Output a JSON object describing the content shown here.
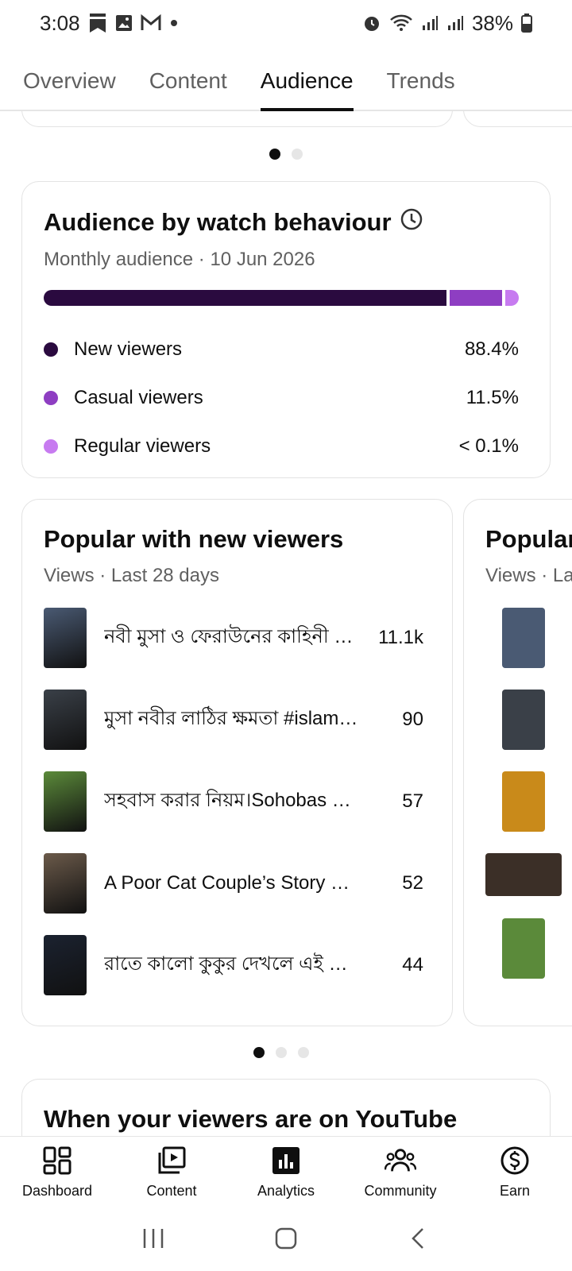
{
  "status_bar": {
    "time": "3:08",
    "battery": "38%",
    "icons": [
      "bookmark-icon",
      "image-icon",
      "gmail-icon",
      "dot-icon",
      "alarm-icon",
      "wifi-icon",
      "signal-icon",
      "signal-icon",
      "battery-icon"
    ]
  },
  "tabs": [
    {
      "label": "Overview",
      "active": false
    },
    {
      "label": "Content",
      "active": false
    },
    {
      "label": "Audience",
      "active": true
    },
    {
      "label": "Trends",
      "active": false
    }
  ],
  "watch_behaviour": {
    "title": "Audience by watch behaviour",
    "subtitle": "Monthly audience · 10 Jun 2026",
    "info_icon": "clock-icon",
    "rows": [
      {
        "label": "New viewers",
        "value": "88.4%",
        "share": 88.4,
        "color": "#2a0a3f"
      },
      {
        "label": "Casual viewers",
        "value": "11.5%",
        "share": 11.5,
        "color": "#8e3ec2"
      },
      {
        "label": "Regular viewers",
        "value": "< 0.1%",
        "share": 0.1,
        "color": "#c77bf0"
      }
    ]
  },
  "popular_new": {
    "title": "Popular with new viewers",
    "subtitle": "Views · Last 28 days",
    "videos": [
      {
        "title": "নবী মুসা ও ফেরাউনের কাহিনী ও জীবনী",
        "views": "11.1k",
        "thumb_color": "#4a5a73"
      },
      {
        "title": "মুসা নবীর লাঠির ক্ষমতা #islamic #shorts",
        "views": "90",
        "thumb_color": "#3a4048"
      },
      {
        "title": "সহবাস করার নিয়ম।Sohobas Mas'ala",
        "views": "57",
        "thumb_color": "#5b8a3a"
      },
      {
        "title": "A Poor Cat Couple’s Story From The Street",
        "views": "52",
        "thumb_color": "#6b5a4a"
      },
      {
        "title": "রাতে কালো কুকুর দেখলে এই কাজ করুন",
        "views": "44",
        "thumb_color": "#1b2230"
      }
    ]
  },
  "popular_next": {
    "title": "Popular",
    "subtitle": "Views · La"
  },
  "next_section_title": "When your viewers are on YouTube",
  "bottom_nav": [
    {
      "label": "Dashboard",
      "icon": "dashboard-icon"
    },
    {
      "label": "Content",
      "icon": "content-icon"
    },
    {
      "label": "Analytics",
      "icon": "analytics-icon"
    },
    {
      "label": "Community",
      "icon": "community-icon"
    },
    {
      "label": "Earn",
      "icon": "earn-icon"
    }
  ],
  "system_nav": [
    "recents-icon",
    "home-icon",
    "back-icon"
  ]
}
